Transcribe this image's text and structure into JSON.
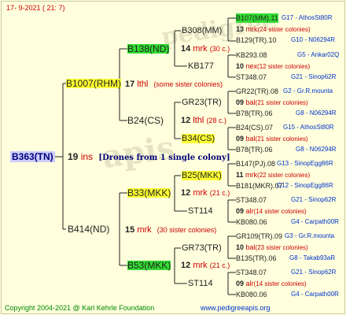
{
  "header": {
    "date": "17-  9-2021  (  21:  7)"
  },
  "footer": {
    "copyright": "Copyright 2004-2021 @ Karl Kehrle Foundation",
    "site": "www.pedigreeapis.org"
  },
  "root": {
    "id": "B363(TN)",
    "num": "19",
    "note": "ins",
    "colony": "[Drones from 1 single colony]"
  },
  "gen1": {
    "upper": {
      "id": "B1007(RHM)",
      "num": "17",
      "note": "lthl",
      "colony": "(some sister colonies)"
    },
    "lower": {
      "id": "B414(ND)",
      "num": "15",
      "note": "mrk",
      "colony": "(30 sister colonies)"
    }
  },
  "gen2": {
    "a": {
      "id": "B138(ND)",
      "num": "14",
      "note": "mrk",
      "colony": "(30 c.)"
    },
    "b": {
      "id": "B24(CS)",
      "num": "12",
      "note": "lthl",
      "colony": "(28 c.)"
    },
    "c": {
      "id": "B33(MKK)",
      "num": "12",
      "note": "mrk",
      "colony": "(21 c.)"
    },
    "d": {
      "id": "B53(MKK)",
      "num": "12",
      "note": "mrk",
      "colony": "(21 c.)"
    }
  },
  "gen3": {
    "a1": {
      "id": "B308(MM)"
    },
    "a2": {
      "id": "KB177"
    },
    "b1": {
      "id": "GR23(TR)"
    },
    "b2": {
      "id": "B34(CS)"
    },
    "c1": {
      "id": "B25(MKK)"
    },
    "c2": {
      "id": "ST114"
    },
    "d1": {
      "id": "GR73(TR)"
    },
    "d2": {
      "id": "ST114"
    }
  },
  "gen4": {
    "a1": {
      "top": "B107(MM).11",
      "topLoc": "G17 - AthosSt80R",
      "num": "13",
      "note": "mrk",
      "colony": "(24 sister colonies)",
      "bot": "B129(TR).10",
      "botLoc": "G10 - N06294R"
    },
    "a2": {
      "top": "KB293.08",
      "topLoc": "G5 - Ankar02Q",
      "num": "10",
      "note": "nex",
      "colony": "(12 sister colonies)",
      "bot": "ST348.07",
      "botLoc": "G21 - Sinop62R"
    },
    "b1": {
      "top": "GR22(TR).08",
      "topLoc": "G2 - Gr.R.mounta",
      "num": "09",
      "note": "bal",
      "colony": "(21 sister colonies)",
      "bot": "B78(TR).06",
      "botLoc": "G8 - N06294R"
    },
    "b2": {
      "top": "B24(CS).07",
      "topLoc": "G15 - AthosSt80R",
      "num": "09",
      "note": "bal",
      "colony": "(21 sister colonies)",
      "bot": "B78(TR).06",
      "botLoc": "G8 - N06294R"
    },
    "c1": {
      "top": "B147(PJ).08",
      "topLoc": "G13 - SinopEgg86R",
      "num": "11",
      "note": "mrk",
      "colony": "(22 sister colonies)",
      "bot": "B181(MKR).07",
      "botLoc": "G12 - SinopEgg86R"
    },
    "c2": {
      "top": "ST348.07",
      "topLoc": "G21 - Sinop62R",
      "num": "09",
      "note": "alr",
      "colony": "(14 sister colonies)",
      "bot": "KB080.06",
      "botLoc": "G4 - Carpath00R"
    },
    "d1": {
      "top": "GR109(TR).09",
      "topLoc": "G3 - Gr.R.mounta",
      "num": "10",
      "note": "bal",
      "colony": "(23 sister colonies)",
      "bot": "B135(TR).06",
      "botLoc": "G8 - Takab93aR"
    },
    "d2": {
      "top": "ST348.07",
      "topLoc": "G21 - Sinop62R",
      "num": "09",
      "note": "alr",
      "colony": "(14 sister colonies)",
      "bot": "KB080.06",
      "botLoc": "G4 - Carpath00R"
    }
  }
}
